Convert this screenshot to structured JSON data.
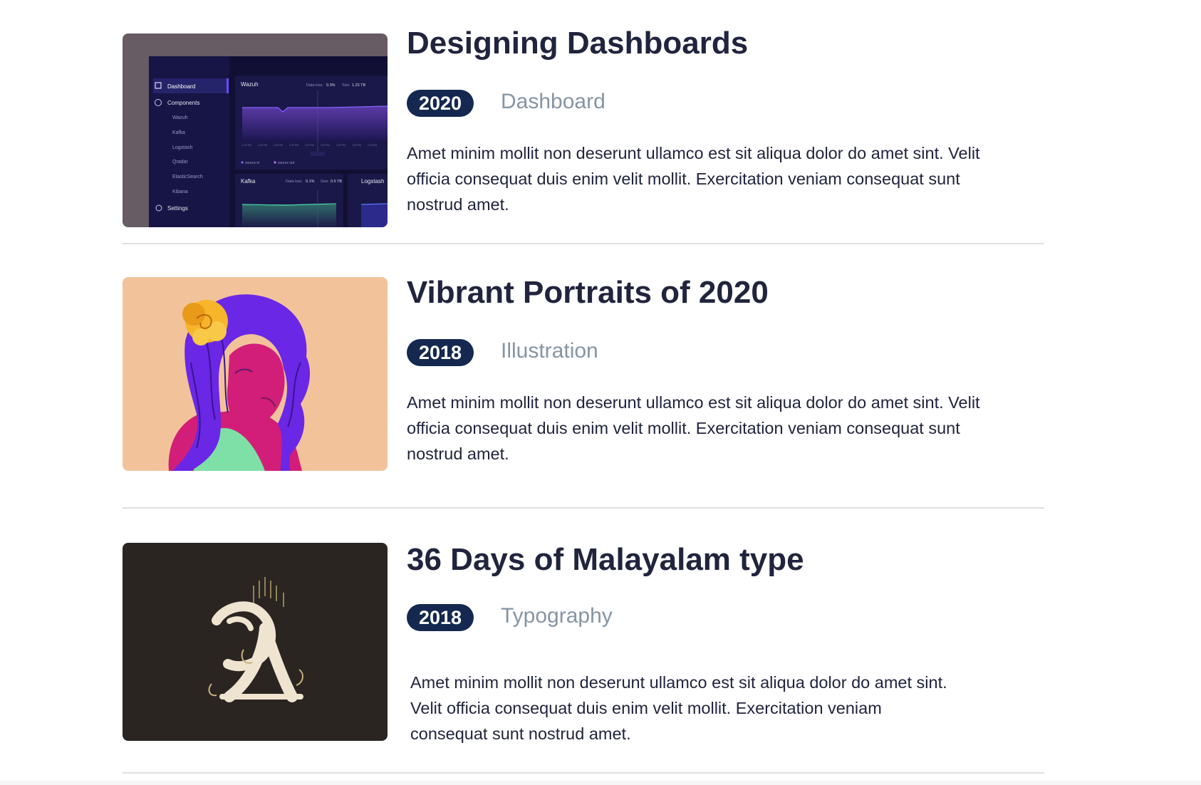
{
  "works": [
    {
      "title": "Designing Dashboards",
      "year": "2020",
      "category": "Dashboard",
      "description": "Amet minim mollit non deserunt ullamco est sit aliqua dolor do amet sint. Velit officia consequat duis enim velit mollit. Exercitation veniam consequat sunt nostrud amet.",
      "thumbnail": {
        "sidebar_items": [
          "Dashboard",
          "Components",
          "Wazuh",
          "Kafka",
          "Logstash",
          "Qradar",
          "ElasticSearch",
          "Kibana",
          "Settings"
        ],
        "panel_top": {
          "title": "Wazuh",
          "data_loss_label": "Data loss",
          "data_loss": "0.3%",
          "size_label": "Size",
          "size": "1.23 TB"
        },
        "panel_bottom_left": {
          "title": "Kafka",
          "data_loss_label": "Data loss",
          "data_loss": "0.1%",
          "size_label": "Size",
          "size": "0.5 TB"
        },
        "panel_bottom_right": {
          "title": "Logstash"
        },
        "legend": [
          "source in",
          "source out"
        ]
      }
    },
    {
      "title": "Vibrant Portraits of 2020",
      "year": "2018",
      "category": "Illustration",
      "description": "Amet minim mollit non deserunt ullamco est sit aliqua dolor do amet sint. Velit officia consequat duis enim velit mollit. Exercitation veniam consequat sunt nostrud amet."
    },
    {
      "title": "36 Days of Malayalam type",
      "year": "2018",
      "category": "Typography",
      "description": "Amet minim mollit non deserunt ullamco est sit aliqua dolor do amet sint. Velit officia consequat duis enim velit mollit. Exercitation veniam consequat sunt nostrud amet."
    }
  ],
  "colors": {
    "badge_bg": "#142850",
    "title": "#21243d",
    "category": "#8695a4",
    "divider": "#e0e0e0"
  }
}
